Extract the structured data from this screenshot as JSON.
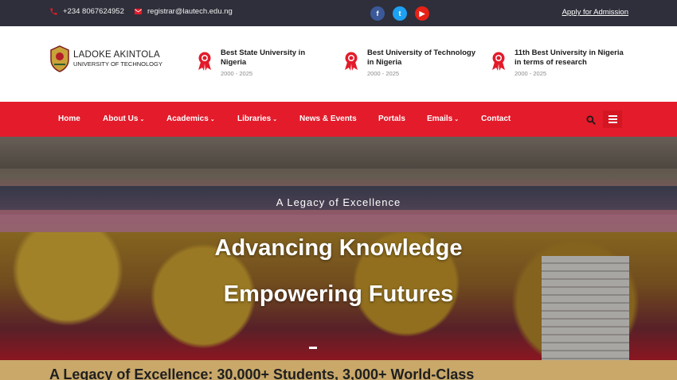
{
  "topbar": {
    "phone": "+234 8067624952",
    "email": "registrar@lautech.edu.ng",
    "socials": [
      {
        "name": "facebook",
        "glyph": "f"
      },
      {
        "name": "twitter",
        "glyph": "t"
      },
      {
        "name": "youtube",
        "glyph": "▶"
      }
    ],
    "apply_link": "Apply for Admission"
  },
  "header": {
    "logo_line1": "LADOKE AKINTOLA",
    "logo_line2": "UNIVERSITY OF TECHNOLOGY",
    "awards": [
      {
        "title": "Best State University in Nigeria",
        "years": "2000 - 2025"
      },
      {
        "title": "Best University of Technology in Nigeria",
        "years": "2000 - 2025"
      },
      {
        "title": "11th Best University in Nigeria in terms of research",
        "years": "2000 - 2025"
      }
    ]
  },
  "nav": {
    "items": [
      {
        "label": "Home",
        "dropdown": false
      },
      {
        "label": "About Us",
        "dropdown": true
      },
      {
        "label": "Academics",
        "dropdown": true
      },
      {
        "label": "Libraries",
        "dropdown": true
      },
      {
        "label": "News & Events",
        "dropdown": false
      },
      {
        "label": "Portals",
        "dropdown": false
      },
      {
        "label": "Emails",
        "dropdown": true
      },
      {
        "label": "Contact",
        "dropdown": false
      }
    ],
    "chevron": "⌄"
  },
  "hero": {
    "tagline": "A Legacy of Excellence",
    "headline_line1": "Advancing Knowledge",
    "headline_line2": "Empowering Futures"
  },
  "banner": {
    "text": "A Legacy of Excellence: 30,000+ Students, 3,000+ World-Class"
  },
  "colors": {
    "topbar": "#2e2f3a",
    "brand_red": "#e31b2a",
    "banner_gold": "#c9a86a"
  }
}
